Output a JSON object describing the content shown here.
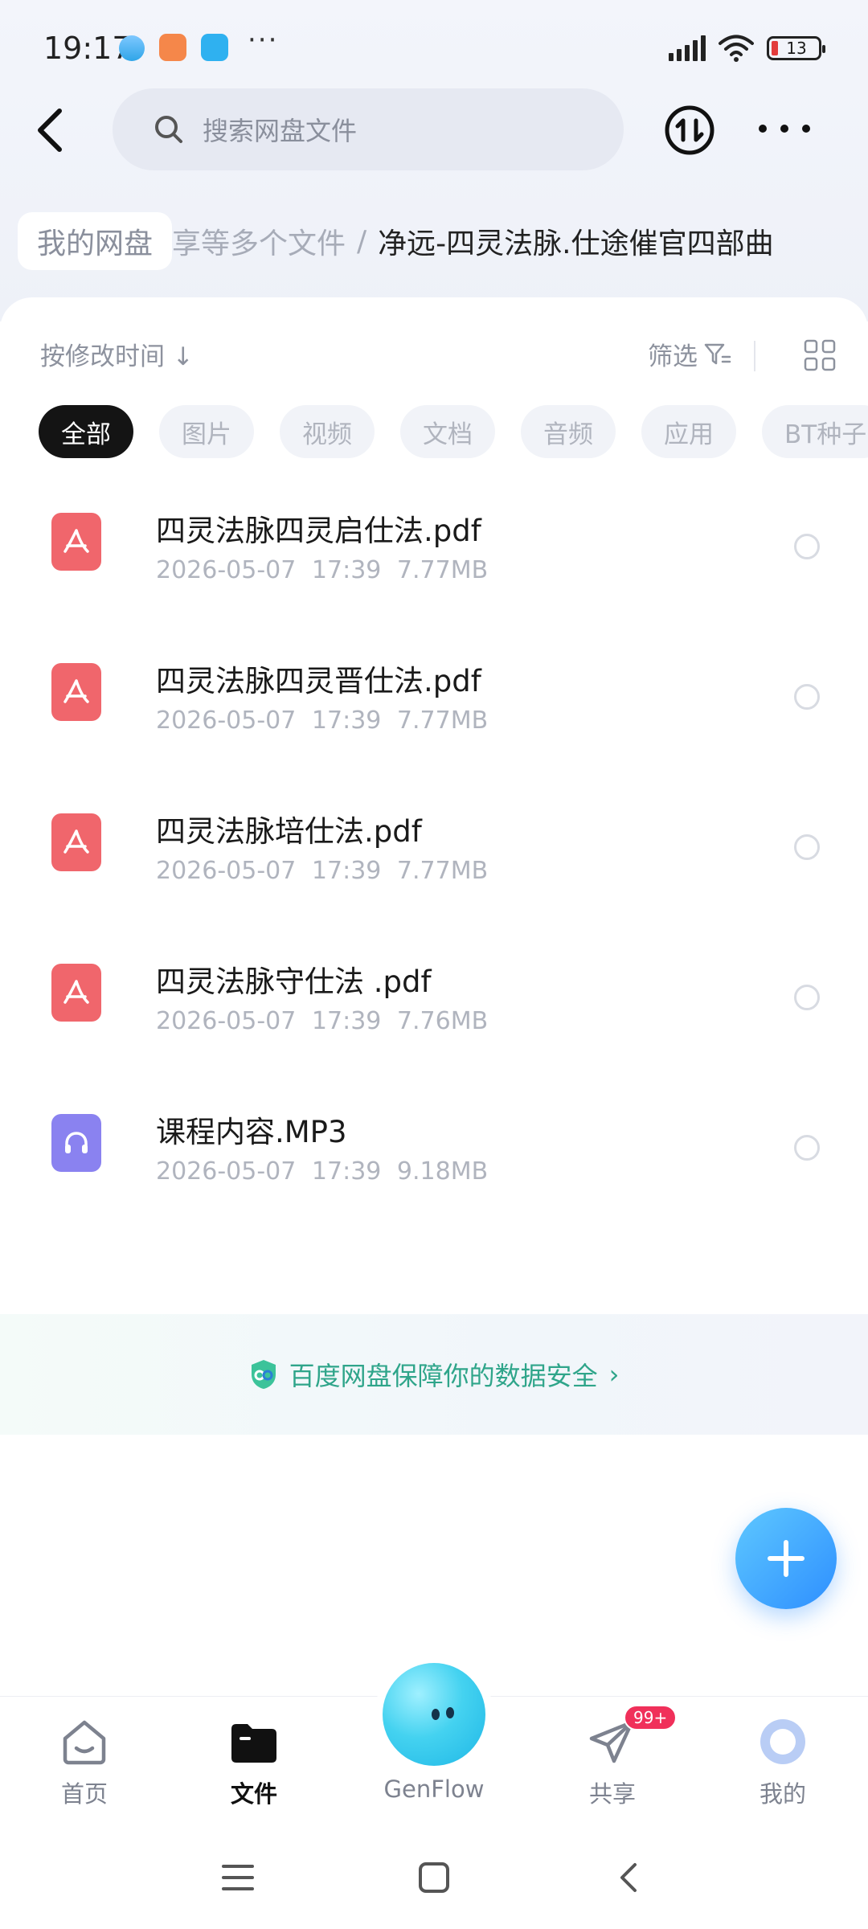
{
  "status_bar": {
    "time": "19:17",
    "dots": "···",
    "battery": "13"
  },
  "header": {
    "search_placeholder": "搜索网盘文件"
  },
  "breadcrumb": {
    "root": "我的网盘",
    "middle": "享等多个文件",
    "separator": "/",
    "current": "净远-四灵法脉.仕途催官四部曲"
  },
  "toolbar": {
    "sort_label": "按修改时间",
    "sort_arrow": "↓",
    "filter_label": "筛选"
  },
  "tabs": [
    {
      "label": "全部",
      "active": true
    },
    {
      "label": "图片",
      "active": false
    },
    {
      "label": "视频",
      "active": false
    },
    {
      "label": "文档",
      "active": false
    },
    {
      "label": "音频",
      "active": false
    },
    {
      "label": "应用",
      "active": false
    },
    {
      "label": "BT种子",
      "active": false
    }
  ],
  "files": [
    {
      "name": "四灵法脉四灵启仕法.pdf",
      "date": "2026-05-07",
      "time": "17:39",
      "size": "7.77MB",
      "icon": "pdf-icon"
    },
    {
      "name": "四灵法脉四灵晋仕法.pdf",
      "date": "2026-05-07",
      "time": "17:39",
      "size": "7.77MB",
      "icon": "pdf-icon"
    },
    {
      "name": "四灵法脉培仕法.pdf",
      "date": "2026-05-07",
      "time": "17:39",
      "size": "7.77MB",
      "icon": "pdf-icon"
    },
    {
      "name": "四灵法脉守仕法 .pdf",
      "date": "2026-05-07",
      "time": "17:39",
      "size": "7.76MB",
      "icon": "pdf-icon"
    },
    {
      "name": "课程内容.MP3",
      "date": "2026-05-07",
      "time": "17:39",
      "size": "9.18MB",
      "icon": "audio-icon"
    }
  ],
  "safety": {
    "text": "百度网盘保障你的数据安全",
    "chevron": "›"
  },
  "bottom_nav": {
    "home": "首页",
    "files": "文件",
    "genflow": "GenFlow",
    "share": "共享",
    "share_badge": "99+",
    "mine": "我的"
  },
  "colors": {
    "accent_blue": "#2e8fff",
    "pdf_red": "#f0666c",
    "audio_purple": "#8a82f0",
    "safety_green": "#2fa58a",
    "badge_red": "#f0305a"
  }
}
